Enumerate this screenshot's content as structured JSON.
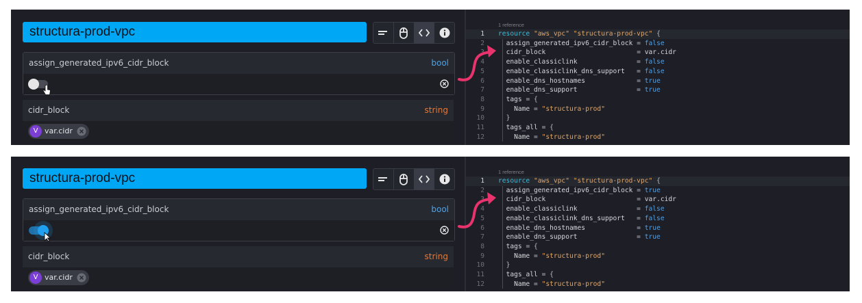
{
  "colors": {
    "accent": "#00a7f5",
    "arrow": "#e8336d",
    "panel": "#1e1f26"
  },
  "panels": [
    {
      "resource_name": "structura-prod-vpc",
      "toolbar_icons": [
        "align-left-icon",
        "mouse-icon",
        "code-icon",
        "info-icon"
      ],
      "attr1": {
        "name": "assign_generated_ipv6_cidr_block",
        "type": "bool",
        "toggle": "off"
      },
      "attr2": {
        "name": "cidr_block",
        "type": "string",
        "chip_badge": "V",
        "chip_label": "var.cidr"
      },
      "code": {
        "reference": "1 reference",
        "lines": [
          {
            "n": "1",
            "text": "resource \"aws_vpc\" \"structura-prod-vpc\" {"
          },
          {
            "n": "2",
            "key": "assign_generated_ipv6_cidr_block",
            "val": "false"
          },
          {
            "n": "3",
            "key": "cidr_block",
            "val": "var.cidr"
          },
          {
            "n": "4",
            "key": "enable_classiclink",
            "val": "false"
          },
          {
            "n": "5",
            "key": "enable_classiclink_dns_support",
            "val": "false"
          },
          {
            "n": "6",
            "key": "enable_dns_hostnames",
            "val": "true"
          },
          {
            "n": "7",
            "key": "enable_dns_support",
            "val": "true"
          },
          {
            "n": "8",
            "text": "tags = {"
          },
          {
            "n": "9",
            "text": "Name = \"structura-prod\""
          },
          {
            "n": "10",
            "text": "}"
          },
          {
            "n": "11",
            "text": "tags_all = {"
          },
          {
            "n": "12",
            "text": "Name = \"structura-prod\""
          }
        ]
      }
    },
    {
      "resource_name": "structura-prod-vpc",
      "toolbar_icons": [
        "align-left-icon",
        "mouse-icon",
        "code-icon",
        "info-icon"
      ],
      "attr1": {
        "name": "assign_generated_ipv6_cidr_block",
        "type": "bool",
        "toggle": "on"
      },
      "attr2": {
        "name": "cidr_block",
        "type": "string",
        "chip_badge": "V",
        "chip_label": "var.cidr"
      },
      "code": {
        "reference": "1 reference",
        "lines": [
          {
            "n": "1",
            "text": "resource \"aws_vpc\" \"structura-prod-vpc\" {"
          },
          {
            "n": "2",
            "key": "assign_generated_ipv6_cidr_block",
            "val": "true"
          },
          {
            "n": "3",
            "key": "cidr_block",
            "val": "var.cidr"
          },
          {
            "n": "4",
            "key": "enable_classiclink",
            "val": "false"
          },
          {
            "n": "5",
            "key": "enable_classiclink_dns_support",
            "val": "false"
          },
          {
            "n": "6",
            "key": "enable_dns_hostnames",
            "val": "true"
          },
          {
            "n": "7",
            "key": "enable_dns_support",
            "val": "true"
          },
          {
            "n": "8",
            "text": "tags = {"
          },
          {
            "n": "9",
            "text": "Name = \"structura-prod\""
          },
          {
            "n": "10",
            "text": "}"
          },
          {
            "n": "11",
            "text": "tags_all = {"
          },
          {
            "n": "12",
            "text": "Name = \"structura-prod\""
          }
        ]
      }
    }
  ]
}
